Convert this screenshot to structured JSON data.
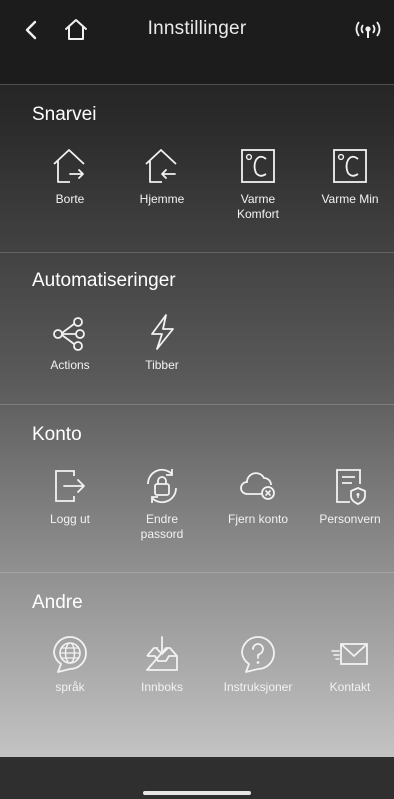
{
  "header": {
    "title": "Innstillinger",
    "back_icon": "chevron-left-icon",
    "home_icon": "home-icon",
    "signal_icon": "broadcast-signal-icon"
  },
  "sections": [
    {
      "title": "Snarvei",
      "items": [
        {
          "label": "Borte",
          "icon": "home-leave-icon"
        },
        {
          "label": "Hjemme",
          "icon": "home-arrive-icon"
        },
        {
          "label": "Varme\nKomfort",
          "icon": "celsius-icon"
        },
        {
          "label": "Varme Min",
          "icon": "celsius-icon"
        }
      ]
    },
    {
      "title": "Automatiseringer",
      "items": [
        {
          "label": "Actions",
          "icon": "share-nodes-icon"
        },
        {
          "label": "Tibber",
          "icon": "lightning-icon"
        }
      ]
    },
    {
      "title": "Konto",
      "items": [
        {
          "label": "Logg ut",
          "icon": "logout-icon"
        },
        {
          "label": "Endre\npassord",
          "icon": "lock-refresh-icon"
        },
        {
          "label": "Fjern konto",
          "icon": "cloud-remove-icon"
        },
        {
          "label": "Personvern",
          "icon": "privacy-document-icon"
        }
      ]
    },
    {
      "title": "Andre",
      "items": [
        {
          "label": "språk",
          "icon": "globe-icon"
        },
        {
          "label": "Innboks",
          "icon": "inbox-icon"
        },
        {
          "label": "Instruksjoner",
          "icon": "help-bubble-icon"
        },
        {
          "label": "Kontakt",
          "icon": "envelope-send-icon"
        }
      ]
    }
  ]
}
